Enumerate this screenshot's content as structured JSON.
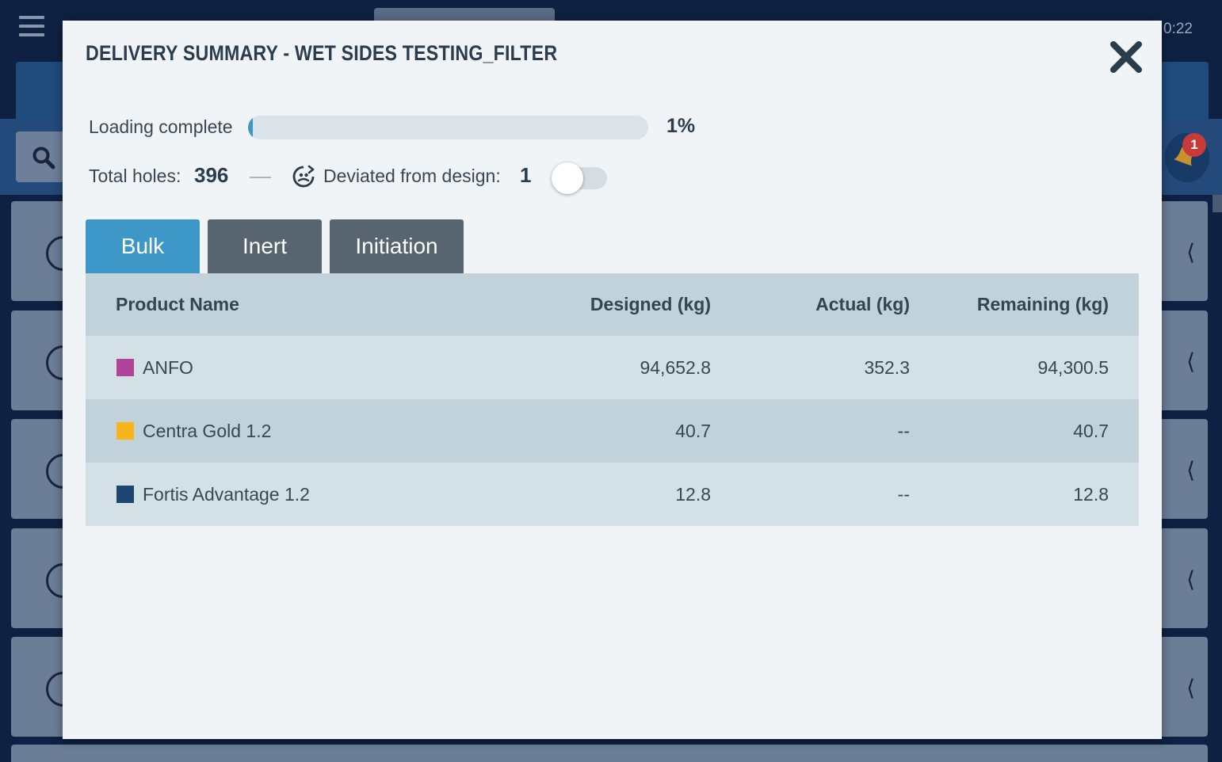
{
  "background": {
    "time": "0:22",
    "notification_count": "1"
  },
  "modal": {
    "title": "DELIVERY SUMMARY - WET SIDES TESTING_FILTER",
    "loading_label": "Loading complete",
    "loading_percent_value": 0.01,
    "loading_percent_text": "1%",
    "total_holes_label": "Total holes:",
    "total_holes_value": "396",
    "deviated_label": "Deviated from design:",
    "deviated_value": "1",
    "deviated_toggle_on": false,
    "tabs": [
      {
        "label": "Bulk",
        "active": true
      },
      {
        "label": "Inert",
        "active": false
      },
      {
        "label": "Initiation",
        "active": false
      }
    ],
    "table": {
      "headers": {
        "product": "Product Name",
        "designed": "Designed  (kg)",
        "actual": "Actual  (kg)",
        "remaining": "Remaining  (kg)"
      },
      "rows": [
        {
          "product": "ANFO",
          "color": "#b0449b",
          "designed": "94,652.8",
          "actual": "352.3",
          "remaining": "94,300.5"
        },
        {
          "product": "Centra Gold 1.2",
          "color": "#f7b51c",
          "designed": "40.7",
          "actual": "--",
          "remaining": "40.7"
        },
        {
          "product": "Fortis Advantage 1.2",
          "color": "#1b4572",
          "designed": "12.8",
          "actual": "--",
          "remaining": "12.8"
        }
      ]
    }
  },
  "colors": {
    "accent": "#3d98c8",
    "tab_inactive": "#56656f",
    "header_row": "#c1d2da",
    "modal_bg": "#f0f4f6",
    "app_bg": "#0e2142"
  },
  "icons": {
    "close": "close-icon",
    "deviated": "deviation-icon",
    "search": "search-icon",
    "menu": "hamburger-menu-icon",
    "bell": "bell-icon"
  }
}
